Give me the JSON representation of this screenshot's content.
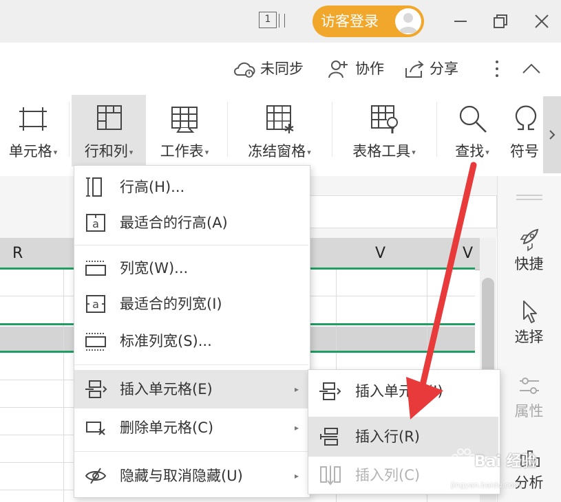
{
  "titlebar": {
    "page_counter": "1",
    "login_label": "访客登录"
  },
  "sync_bar": {
    "sync_label": "未同步",
    "collab_label": "协作",
    "share_label": "分享"
  },
  "ribbon": {
    "items": [
      {
        "label": "单元格"
      },
      {
        "label": "行和列"
      },
      {
        "label": "工作表"
      },
      {
        "label": "冻结窗格"
      },
      {
        "label": "表格工具"
      },
      {
        "label": "查找"
      },
      {
        "label": "符号"
      }
    ]
  },
  "sheet": {
    "columns": [
      "R",
      "V",
      "V"
    ]
  },
  "side_panel": {
    "items": [
      {
        "label": "快捷"
      },
      {
        "label": "选择"
      },
      {
        "label": "属性"
      },
      {
        "label": "分析"
      }
    ]
  },
  "row_col_menu": {
    "items": [
      {
        "label": "行高(H)..."
      },
      {
        "label": "最适合的行高(A)"
      },
      {
        "label": "列宽(W)..."
      },
      {
        "label": "最适合的列宽(I)"
      },
      {
        "label": "标准列宽(S)..."
      },
      {
        "label": "插入单元格(E)",
        "has_submenu": true,
        "hovered": true
      },
      {
        "label": "删除单元格(C)",
        "has_submenu": true
      },
      {
        "label": "隐藏与取消隐藏(U)",
        "has_submenu": true
      }
    ]
  },
  "insert_submenu": {
    "items": [
      {
        "label": "插入单元格(I)"
      },
      {
        "label": "插入行(R)",
        "hovered": true
      },
      {
        "label": "插入列(C)",
        "disabled": true
      }
    ]
  },
  "watermark": {
    "line1": "Bai 经验",
    "line2": "jingyan.baidu.com"
  },
  "colors": {
    "accent_orange": "#f1a72b",
    "selection_green": "#1f9e64",
    "annotation_red": "#e83a3a"
  }
}
